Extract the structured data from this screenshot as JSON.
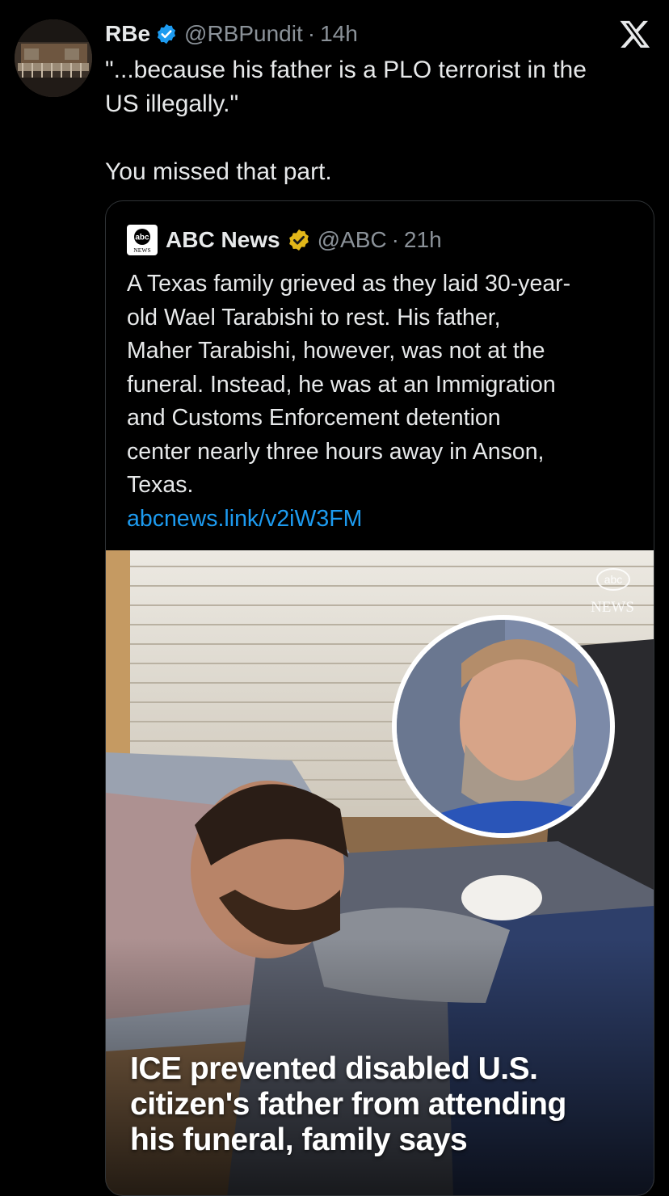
{
  "tweet": {
    "author_name": "RBe",
    "author_handle": "@RBPundit",
    "separator": "·",
    "time": "14h",
    "text_line1": "\"...because his father is a PLO terrorist in the",
    "text_line2": "US illegally.\"",
    "text_line3": "You missed that part."
  },
  "quoted_tweet": {
    "author_name": "ABC News",
    "author_handle": "@ABC",
    "separator": "·",
    "time": "21h",
    "lines": [
      "A Texas family grieved as they laid 30-year-",
      "old Wael Tarabishi to rest. His father,",
      "Maher Tarabishi, however, was not at the",
      "funeral. Instead, he was at an Immigration",
      "and Customs Enforcement detention",
      "center nearly three hours away in Anson,",
      "Texas."
    ],
    "link": "abcnews.link/v2iW3FM",
    "media": {
      "watermark_top": "abc",
      "watermark_bottom": "NEWS",
      "headline_lines": [
        "ICE prevented disabled U.S.",
        "citizen's father from attending",
        "his funeral, family says"
      ]
    }
  },
  "logo_text": {
    "abc": "abc",
    "news": "NEWS"
  },
  "icons": {
    "verified": "verified-badge-icon",
    "gold_verified": "gold-verified-badge-icon",
    "x_logo": "x-logo-icon"
  },
  "colors": {
    "background": "#000000",
    "text": "#e7e9ea",
    "muted": "#8b9299",
    "link": "#1d9bf0",
    "verified_blue": "#1d9bf0",
    "verified_gold": "#e2b719",
    "border": "#2f3336"
  }
}
